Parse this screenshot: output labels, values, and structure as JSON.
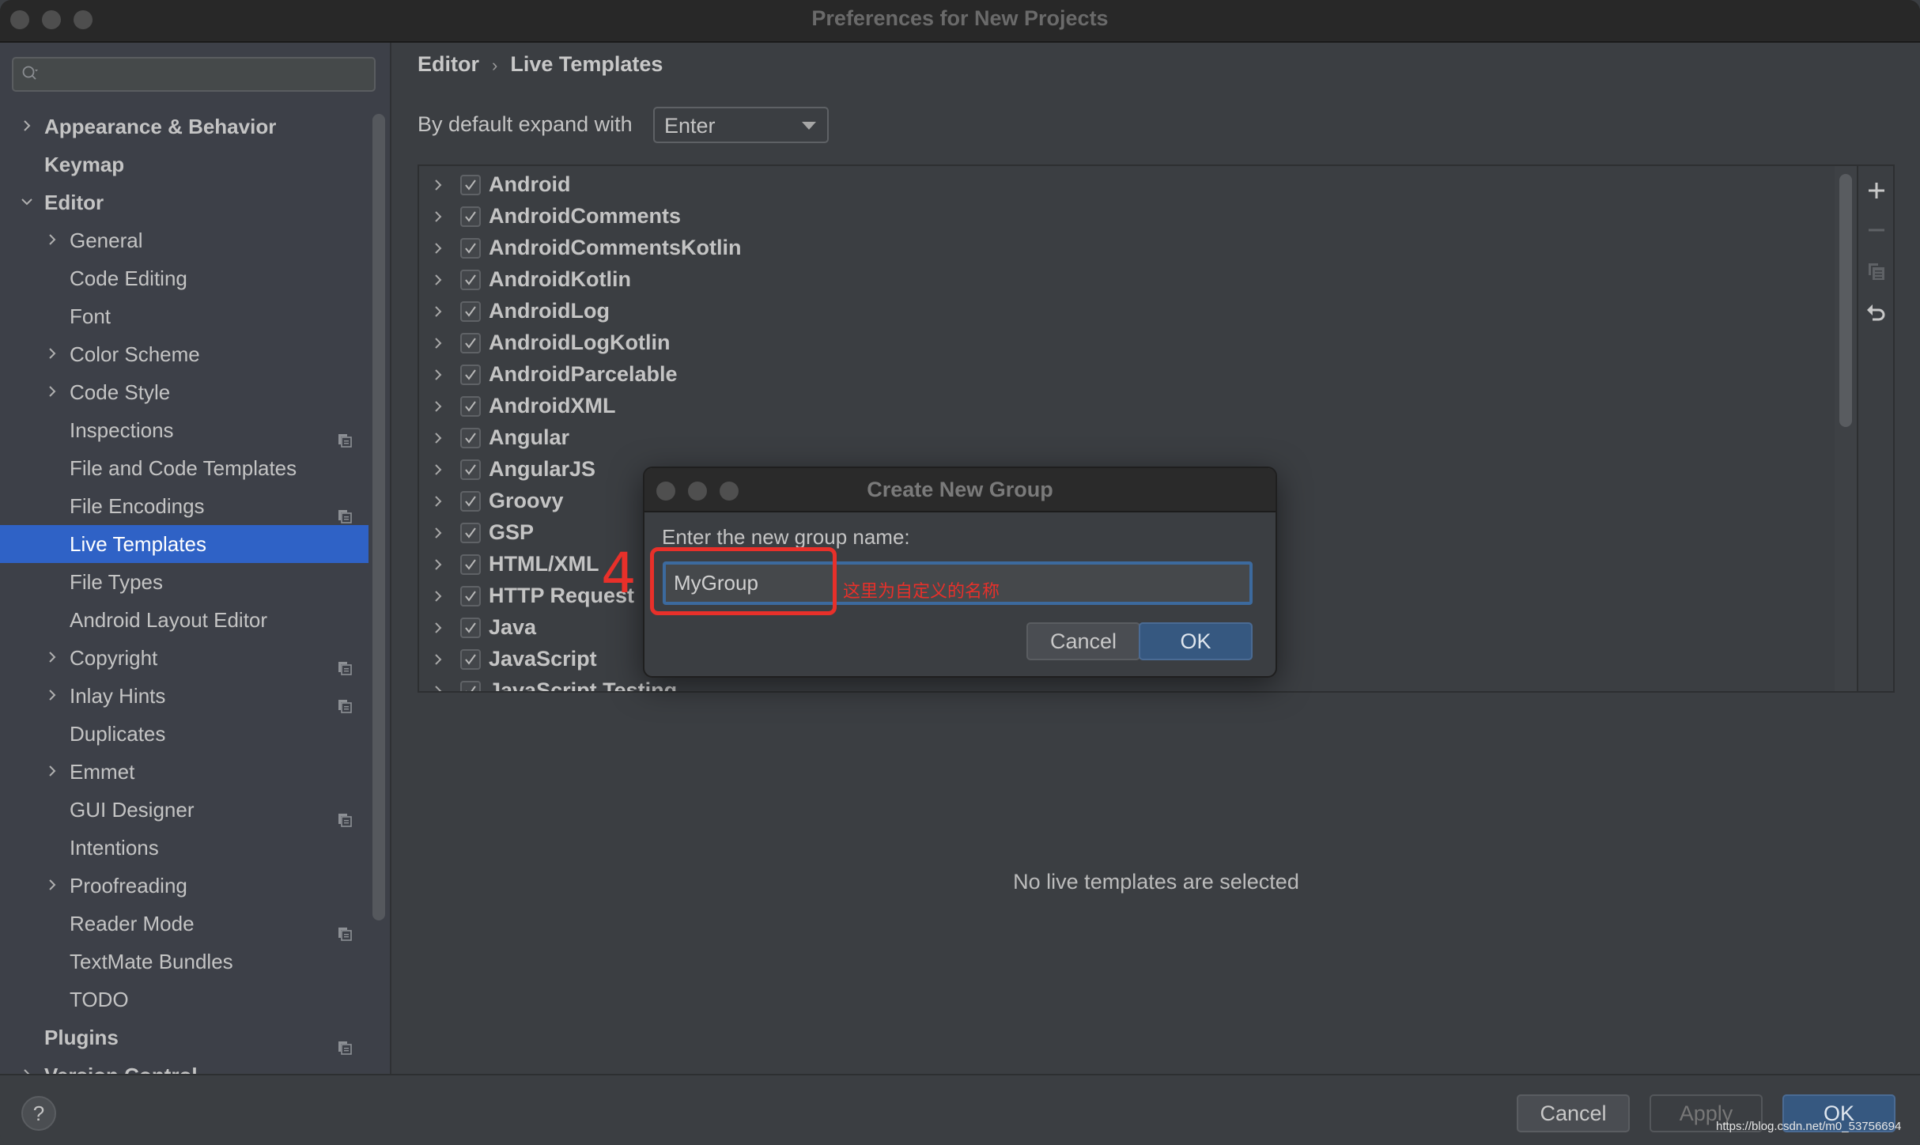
{
  "window": {
    "title": "Preferences for New Projects"
  },
  "sidebar": {
    "search_placeholder": "",
    "items": [
      {
        "label": "Appearance & Behavior",
        "level": 0,
        "bold": true,
        "chevron": "right",
        "badge": false
      },
      {
        "label": "Keymap",
        "level": 0,
        "bold": true,
        "chevron": "none",
        "badge": false
      },
      {
        "label": "Editor",
        "level": 0,
        "bold": true,
        "chevron": "down",
        "badge": false
      },
      {
        "label": "General",
        "level": 1,
        "bold": false,
        "chevron": "right",
        "badge": false
      },
      {
        "label": "Code Editing",
        "level": 1,
        "bold": false,
        "chevron": "none",
        "badge": false
      },
      {
        "label": "Font",
        "level": 1,
        "bold": false,
        "chevron": "none",
        "badge": false
      },
      {
        "label": "Color Scheme",
        "level": 1,
        "bold": false,
        "chevron": "right",
        "badge": false
      },
      {
        "label": "Code Style",
        "level": 1,
        "bold": false,
        "chevron": "right",
        "badge": false
      },
      {
        "label": "Inspections",
        "level": 1,
        "bold": false,
        "chevron": "none",
        "badge": true
      },
      {
        "label": "File and Code Templates",
        "level": 1,
        "bold": false,
        "chevron": "none",
        "badge": false
      },
      {
        "label": "File Encodings",
        "level": 1,
        "bold": false,
        "chevron": "none",
        "badge": true
      },
      {
        "label": "Live Templates",
        "level": 1,
        "bold": false,
        "chevron": "none",
        "badge": false,
        "selected": true
      },
      {
        "label": "File Types",
        "level": 1,
        "bold": false,
        "chevron": "none",
        "badge": false
      },
      {
        "label": "Android Layout Editor",
        "level": 1,
        "bold": false,
        "chevron": "none",
        "badge": false
      },
      {
        "label": "Copyright",
        "level": 1,
        "bold": false,
        "chevron": "right",
        "badge": true
      },
      {
        "label": "Inlay Hints",
        "level": 1,
        "bold": false,
        "chevron": "right",
        "badge": true
      },
      {
        "label": "Duplicates",
        "level": 1,
        "bold": false,
        "chevron": "none",
        "badge": false
      },
      {
        "label": "Emmet",
        "level": 1,
        "bold": false,
        "chevron": "right",
        "badge": false
      },
      {
        "label": "GUI Designer",
        "level": 1,
        "bold": false,
        "chevron": "none",
        "badge": true
      },
      {
        "label": "Intentions",
        "level": 1,
        "bold": false,
        "chevron": "none",
        "badge": false
      },
      {
        "label": "Proofreading",
        "level": 1,
        "bold": false,
        "chevron": "right",
        "badge": false
      },
      {
        "label": "Reader Mode",
        "level": 1,
        "bold": false,
        "chevron": "none",
        "badge": true
      },
      {
        "label": "TextMate Bundles",
        "level": 1,
        "bold": false,
        "chevron": "none",
        "badge": false
      },
      {
        "label": "TODO",
        "level": 1,
        "bold": false,
        "chevron": "none",
        "badge": false
      },
      {
        "label": "Plugins",
        "level": 0,
        "bold": true,
        "chevron": "none",
        "badge": true
      },
      {
        "label": "Version Control",
        "level": 0,
        "bold": true,
        "chevron": "right",
        "badge": true
      }
    ]
  },
  "main": {
    "breadcrumb": [
      "Editor",
      "Live Templates"
    ],
    "breadcrumb_separator": "›",
    "expand_label": "By default expand with",
    "expand_value": "Enter",
    "template_groups": [
      {
        "label": "Android",
        "checked": true
      },
      {
        "label": "AndroidComments",
        "checked": true
      },
      {
        "label": "AndroidCommentsKotlin",
        "checked": true
      },
      {
        "label": "AndroidKotlin",
        "checked": true
      },
      {
        "label": "AndroidLog",
        "checked": true
      },
      {
        "label": "AndroidLogKotlin",
        "checked": true
      },
      {
        "label": "AndroidParcelable",
        "checked": true
      },
      {
        "label": "AndroidXML",
        "checked": true
      },
      {
        "label": "Angular",
        "checked": true
      },
      {
        "label": "AngularJS",
        "checked": true
      },
      {
        "label": "Groovy",
        "checked": true
      },
      {
        "label": "GSP",
        "checked": true
      },
      {
        "label": "HTML/XML",
        "checked": true
      },
      {
        "label": "HTTP Request",
        "checked": true
      },
      {
        "label": "Java",
        "checked": true
      },
      {
        "label": "JavaScript",
        "checked": true
      },
      {
        "label": "JavaScript Testing",
        "checked": true
      }
    ],
    "toolbar": {
      "add_icon": "plus-icon",
      "remove_icon": "minus-icon",
      "copy_icon": "copy-icon",
      "restore_icon": "undo-icon"
    },
    "empty_message": "No live templates are selected"
  },
  "footer": {
    "help_label": "?",
    "cancel_label": "Cancel",
    "apply_label": "Apply",
    "ok_label": "OK"
  },
  "dialog": {
    "title": "Create New Group",
    "prompt": "Enter the new group name:",
    "input_value": "MyGroup",
    "cancel_label": "Cancel",
    "ok_label": "OK"
  },
  "annotation": {
    "step_number": "4",
    "note": "这里为自定义的名称",
    "color": "#e8302a"
  },
  "watermark": "https://blog.csdn.net/m0_53756694",
  "colors": {
    "selection": "#2f62c6",
    "primary_button": "#365880",
    "input_focus": "#3c6a9e"
  }
}
